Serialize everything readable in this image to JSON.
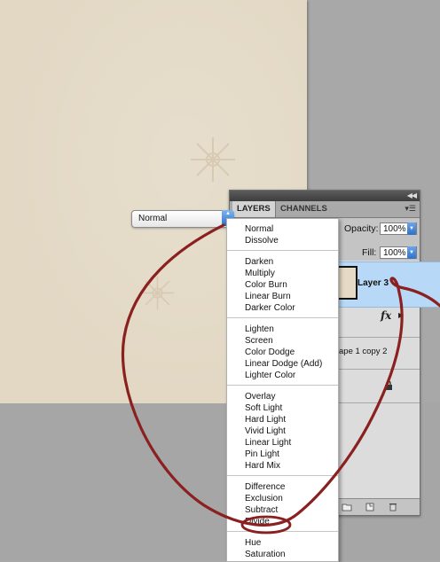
{
  "panel": {
    "tabs": [
      "LAYERS",
      "CHANNELS"
    ],
    "opacity_label": "Opacity:",
    "opacity_value": "100%",
    "fill_label": "Fill:",
    "fill_value": "100%",
    "layer_name": "Layer 3",
    "partial_layer_text": "ape 1 copy 2",
    "fx_label": "fx"
  },
  "blend_select": {
    "selected": "Normal"
  },
  "blend_menu": {
    "groups": [
      [
        "Normal",
        "Dissolve"
      ],
      [
        "Darken",
        "Multiply",
        "Color Burn",
        "Linear Burn",
        "Darker Color"
      ],
      [
        "Lighten",
        "Screen",
        "Color Dodge",
        "Linear Dodge (Add)",
        "Lighter Color"
      ],
      [
        "Overlay",
        "Soft Light",
        "Hard Light",
        "Vivid Light",
        "Linear Light",
        "Pin Light",
        "Hard Mix"
      ],
      [
        "Difference",
        "Exclusion",
        "Subtract",
        "Divide"
      ],
      [
        "Hue",
        "Saturation"
      ]
    ],
    "highlighted_item": "Divide"
  },
  "colors": {
    "annotation": "#8b2020",
    "selection_blue": "#b7d8f6",
    "paper": "#e2d8c4"
  },
  "icons": [
    "eye-icon",
    "lock-icon",
    "new-layer-icon",
    "group-folder-icon",
    "delete-layer-icon",
    "panel-menu-icon",
    "collapse-icon",
    "dropdown-arrow-icon"
  ]
}
